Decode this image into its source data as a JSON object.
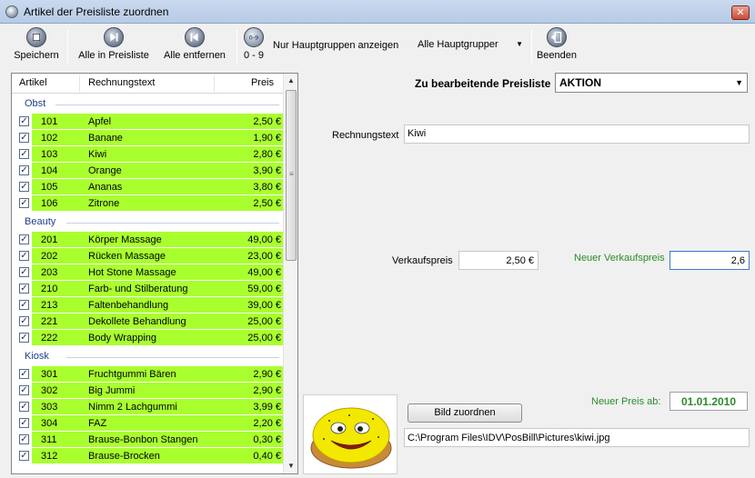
{
  "window": {
    "title": "Artikel der Preisliste zuordnen",
    "close_symbol": "✕"
  },
  "toolbar": {
    "save_label": "Speichern",
    "all_in_label": "Alle in Preisliste",
    "all_out_label": "Alle entfernen",
    "range_label": "0 - 9",
    "hauptgruppen_label": "Nur Hauptgruppen anzeigen",
    "hauptgruppen_value": "Alle Hauptgrupper",
    "exit_label": "Beenden"
  },
  "list": {
    "columns": [
      "Artikel",
      "Rechnungstext",
      "Preis"
    ],
    "groups": [
      {
        "name": "Obst",
        "rows": [
          {
            "artikel": "101",
            "text": "Apfel",
            "preis": "2,50 €"
          },
          {
            "artikel": "102",
            "text": "Banane",
            "preis": "1,90 €"
          },
          {
            "artikel": "103",
            "text": "Kiwi",
            "preis": "2,80 €"
          },
          {
            "artikel": "104",
            "text": "Orange",
            "preis": "3,90 €"
          },
          {
            "artikel": "105",
            "text": "Ananas",
            "preis": "3,80 €"
          },
          {
            "artikel": "106",
            "text": "Zitrone",
            "preis": "2,50 €"
          }
        ]
      },
      {
        "name": "Beauty",
        "rows": [
          {
            "artikel": "201",
            "text": "Körper Massage",
            "preis": "49,00 €"
          },
          {
            "artikel": "202",
            "text": "Rücken Massage",
            "preis": "23,00 €"
          },
          {
            "artikel": "203",
            "text": "Hot Stone Massage",
            "preis": "49,00 €"
          },
          {
            "artikel": "210",
            "text": "Farb- und Stilberatung",
            "preis": "59,00 €"
          },
          {
            "artikel": "213",
            "text": "Faltenbehandlung",
            "preis": "39,00 €"
          },
          {
            "artikel": "221",
            "text": "Dekollete Behandlung",
            "preis": "25,00 €"
          },
          {
            "artikel": "222",
            "text": "Body Wrapping",
            "preis": "25,00 €"
          }
        ]
      },
      {
        "name": "Kiosk",
        "rows": [
          {
            "artikel": "301",
            "text": "Fruchtgummi Bären",
            "preis": "2,90 €"
          },
          {
            "artikel": "302",
            "text": "Big Jummi",
            "preis": "2,90 €"
          },
          {
            "artikel": "303",
            "text": "Nimm 2 Lachgummi",
            "preis": "3,99 €"
          },
          {
            "artikel": "304",
            "text": "FAZ",
            "preis": "2,20 €"
          },
          {
            "artikel": "311",
            "text": "Brause-Bonbon Stangen",
            "preis": "0,30 €"
          },
          {
            "artikel": "312",
            "text": "Brause-Brocken",
            "preis": "0,40 €"
          }
        ]
      }
    ],
    "check_symbol": "✓"
  },
  "form": {
    "preisliste_label": "Zu bearbeitende Preisliste",
    "preisliste_value": "AKTION",
    "rechnungstext_label": "Rechnungstext",
    "rechnungstext_value": "Kiwi",
    "verkaufspreis_label": "Verkaufspreis",
    "verkaufspreis_value": "2,50 €",
    "neuer_vk_label": "Neuer Verkaufspreis",
    "neuer_vk_value": "2,6",
    "neuer_preis_ab_label": "Neuer Preis ab:",
    "neuer_preis_ab_value": "01.01.2010",
    "bild_button": "Bild zuordnen",
    "bild_path": "C:\\Program Files\\IDV\\PosBill\\Pictures\\kiwi.jpg"
  },
  "colors": {
    "row_green": "#a9ff2e",
    "label_green": "#2b8b2b",
    "group_blue": "#1e3f8a"
  }
}
